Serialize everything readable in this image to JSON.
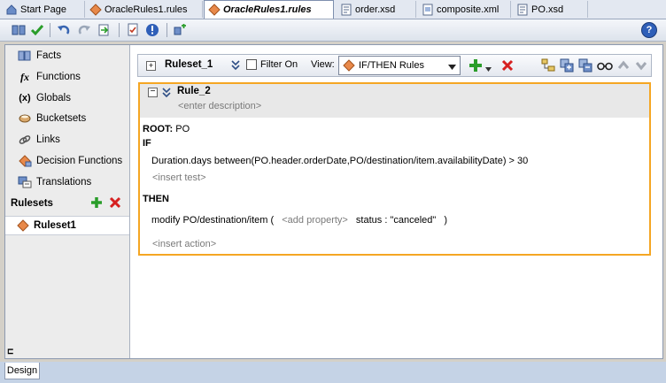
{
  "tabs": [
    {
      "label": "Start Page",
      "icon": "home-icon"
    },
    {
      "label": "OracleRules1.rules",
      "icon": "rules-diamond-icon"
    },
    {
      "label": "OracleRules1.rules",
      "icon": "rules-diamond-icon"
    },
    {
      "label": "order.xsd",
      "icon": "xsd-file-icon"
    },
    {
      "label": "composite.xml",
      "icon": "composite-file-icon"
    },
    {
      "label": "PO.xsd",
      "icon": "xsd-file-icon"
    }
  ],
  "toolbar": {
    "icons": [
      "book-icon",
      "validate-check-icon",
      "undo-icon",
      "redo-icon",
      "export-icon",
      "report-icon",
      "info-icon",
      "test-icon"
    ],
    "help": "?"
  },
  "sidebar": {
    "items": [
      {
        "label": "Facts",
        "icon": "facts-icon"
      },
      {
        "label": "Functions",
        "icon": "functions-icon",
        "glyph": "fx"
      },
      {
        "label": "Globals",
        "icon": "globals-icon",
        "glyph": "(x)"
      },
      {
        "label": "Bucketsets",
        "icon": "bucketsets-icon"
      },
      {
        "label": "Links",
        "icon": "links-icon"
      },
      {
        "label": "Decision Functions",
        "icon": "decision-functions-icon"
      },
      {
        "label": "Translations",
        "icon": "translations-icon"
      }
    ],
    "rulesets_title": "Rulesets",
    "ruleset_item": "Ruleset1",
    "collapse_glyph": "⊏"
  },
  "ruleset_bar": {
    "name": "Ruleset_1",
    "filter_label": "Filter On",
    "view_label": "View:",
    "view_value": "IF/THEN Rules"
  },
  "rule": {
    "name": "Rule_2",
    "description_placeholder": "<enter description>",
    "root_label": "ROOT:",
    "root_value": "PO",
    "if_label": "IF",
    "condition": "Duration.days between(PO.header.orderDate,PO/destination/item.availabilityDate)  >  30",
    "insert_test": "<insert test>",
    "then_label": "THEN",
    "action_prefix": "modify PO/destination/item (",
    "add_property": "<add property>",
    "action_assign": "status : \"canceled\"",
    "action_close": ")",
    "insert_action": "<insert action>"
  },
  "bottom": {
    "design_tab": "Design"
  },
  "colors": {
    "accent_border": "#f5a623",
    "add_green": "#2a9d2a",
    "delete_red": "#d62020"
  }
}
